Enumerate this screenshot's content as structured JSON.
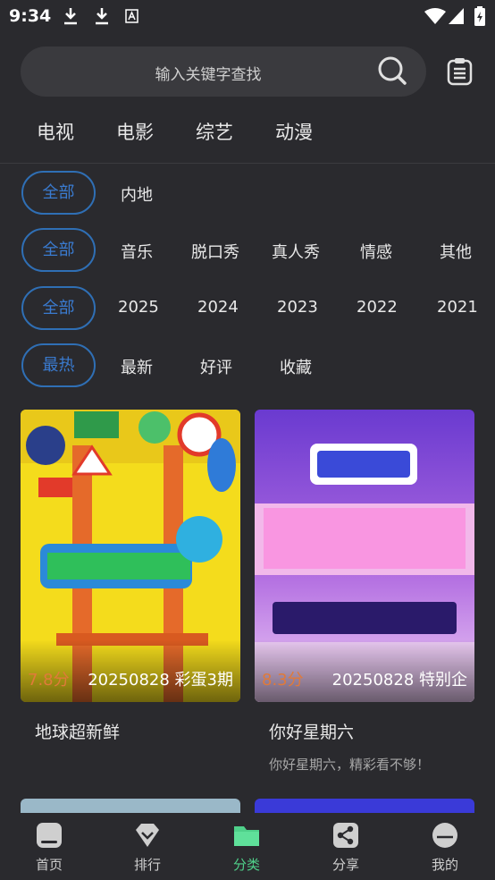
{
  "status_bar": {
    "time": "9:34"
  },
  "search": {
    "placeholder": "输入关键字查找"
  },
  "category_tabs": [
    "电视",
    "电影",
    "综艺",
    "动漫"
  ],
  "filters": {
    "region": {
      "selected": "全部",
      "options": [
        "内地"
      ]
    },
    "genre": {
      "selected": "全部",
      "options": [
        "音乐",
        "脱口秀",
        "真人秀",
        "情感",
        "其他"
      ]
    },
    "year": {
      "selected": "全部",
      "options": [
        "2025",
        "2024",
        "2023",
        "2022",
        "2021"
      ]
    },
    "sort": {
      "selected": "最热",
      "options": [
        "最新",
        "好评",
        "收藏"
      ]
    }
  },
  "cards": [
    {
      "score": "7.8分",
      "episode": "20250828 彩蛋3期",
      "title": "地球超新鲜",
      "subtitle": ""
    },
    {
      "score": "8.3分",
      "episode": "20250828 特别企",
      "title": "你好星期六",
      "subtitle": "你好星期六，精彩看不够！"
    }
  ],
  "bottom_nav": [
    {
      "label": "首页",
      "icon": "home-icon"
    },
    {
      "label": "排行",
      "icon": "ranking-icon"
    },
    {
      "label": "分类",
      "icon": "folder-icon",
      "active": true
    },
    {
      "label": "分享",
      "icon": "share-icon"
    },
    {
      "label": "我的",
      "icon": "profile-icon"
    }
  ],
  "colors": {
    "accent": "#4fd08a",
    "chip": "#2f6fb5",
    "score": "#e07a3a",
    "background": "#2a2a2e"
  }
}
